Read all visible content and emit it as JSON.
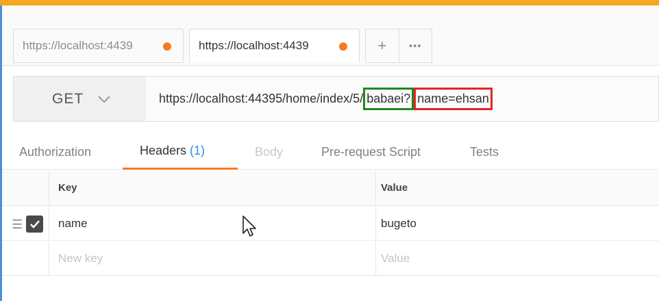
{
  "tabs": [
    {
      "label": "https://localhost:4439",
      "unsaved": true,
      "active": false
    },
    {
      "label": "https://localhost:4439",
      "unsaved": true,
      "active": true
    }
  ],
  "tab_actions": {
    "add": "+",
    "more": "•••"
  },
  "request": {
    "method": "GET",
    "url_prefix": "https://localhost:44395/home/index/5/",
    "url_green": "babaei",
    "url_separator": "?",
    "url_red": "name=ehsan"
  },
  "subtabs": {
    "authorization": "Authorization",
    "headers": "Headers",
    "headers_count": "(1)",
    "body": "Body",
    "prerequest": "Pre-request Script",
    "tests": "Tests"
  },
  "headers_table": {
    "key_header": "Key",
    "value_header": "Value",
    "rows": [
      {
        "key": "name",
        "value": "bugeto",
        "checked": true
      }
    ],
    "new_key_placeholder": "New key",
    "new_value_placeholder": "Value"
  },
  "colors": {
    "accent": "#f47b20",
    "highlight_green": "#1a8a1a",
    "highlight_red": "#e52222",
    "count_blue": "#2e8de6",
    "top_bar": "#f5a623"
  }
}
